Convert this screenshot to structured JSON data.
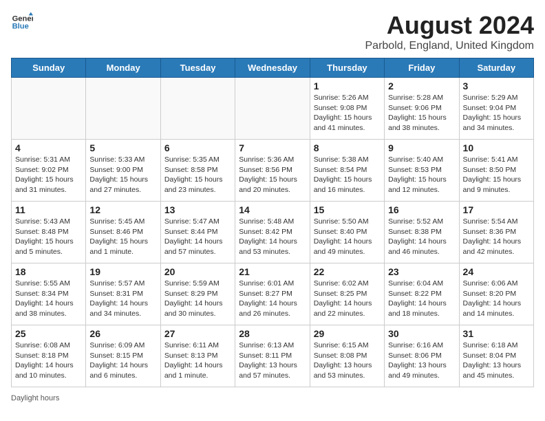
{
  "header": {
    "logo_line1": "General",
    "logo_line2": "Blue",
    "main_title": "August 2024",
    "subtitle": "Parbold, England, United Kingdom"
  },
  "day_headers": [
    "Sunday",
    "Monday",
    "Tuesday",
    "Wednesday",
    "Thursday",
    "Friday",
    "Saturday"
  ],
  "weeks": [
    [
      {
        "date": "",
        "text": ""
      },
      {
        "date": "",
        "text": ""
      },
      {
        "date": "",
        "text": ""
      },
      {
        "date": "",
        "text": ""
      },
      {
        "date": "1",
        "text": "Sunrise: 5:26 AM\nSunset: 9:08 PM\nDaylight: 15 hours\nand 41 minutes."
      },
      {
        "date": "2",
        "text": "Sunrise: 5:28 AM\nSunset: 9:06 PM\nDaylight: 15 hours\nand 38 minutes."
      },
      {
        "date": "3",
        "text": "Sunrise: 5:29 AM\nSunset: 9:04 PM\nDaylight: 15 hours\nand 34 minutes."
      }
    ],
    [
      {
        "date": "4",
        "text": "Sunrise: 5:31 AM\nSunset: 9:02 PM\nDaylight: 15 hours\nand 31 minutes."
      },
      {
        "date": "5",
        "text": "Sunrise: 5:33 AM\nSunset: 9:00 PM\nDaylight: 15 hours\nand 27 minutes."
      },
      {
        "date": "6",
        "text": "Sunrise: 5:35 AM\nSunset: 8:58 PM\nDaylight: 15 hours\nand 23 minutes."
      },
      {
        "date": "7",
        "text": "Sunrise: 5:36 AM\nSunset: 8:56 PM\nDaylight: 15 hours\nand 20 minutes."
      },
      {
        "date": "8",
        "text": "Sunrise: 5:38 AM\nSunset: 8:54 PM\nDaylight: 15 hours\nand 16 minutes."
      },
      {
        "date": "9",
        "text": "Sunrise: 5:40 AM\nSunset: 8:53 PM\nDaylight: 15 hours\nand 12 minutes."
      },
      {
        "date": "10",
        "text": "Sunrise: 5:41 AM\nSunset: 8:50 PM\nDaylight: 15 hours\nand 9 minutes."
      }
    ],
    [
      {
        "date": "11",
        "text": "Sunrise: 5:43 AM\nSunset: 8:48 PM\nDaylight: 15 hours\nand 5 minutes."
      },
      {
        "date": "12",
        "text": "Sunrise: 5:45 AM\nSunset: 8:46 PM\nDaylight: 15 hours\nand 1 minute."
      },
      {
        "date": "13",
        "text": "Sunrise: 5:47 AM\nSunset: 8:44 PM\nDaylight: 14 hours\nand 57 minutes."
      },
      {
        "date": "14",
        "text": "Sunrise: 5:48 AM\nSunset: 8:42 PM\nDaylight: 14 hours\nand 53 minutes."
      },
      {
        "date": "15",
        "text": "Sunrise: 5:50 AM\nSunset: 8:40 PM\nDaylight: 14 hours\nand 49 minutes."
      },
      {
        "date": "16",
        "text": "Sunrise: 5:52 AM\nSunset: 8:38 PM\nDaylight: 14 hours\nand 46 minutes."
      },
      {
        "date": "17",
        "text": "Sunrise: 5:54 AM\nSunset: 8:36 PM\nDaylight: 14 hours\nand 42 minutes."
      }
    ],
    [
      {
        "date": "18",
        "text": "Sunrise: 5:55 AM\nSunset: 8:34 PM\nDaylight: 14 hours\nand 38 minutes."
      },
      {
        "date": "19",
        "text": "Sunrise: 5:57 AM\nSunset: 8:31 PM\nDaylight: 14 hours\nand 34 minutes."
      },
      {
        "date": "20",
        "text": "Sunrise: 5:59 AM\nSunset: 8:29 PM\nDaylight: 14 hours\nand 30 minutes."
      },
      {
        "date": "21",
        "text": "Sunrise: 6:01 AM\nSunset: 8:27 PM\nDaylight: 14 hours\nand 26 minutes."
      },
      {
        "date": "22",
        "text": "Sunrise: 6:02 AM\nSunset: 8:25 PM\nDaylight: 14 hours\nand 22 minutes."
      },
      {
        "date": "23",
        "text": "Sunrise: 6:04 AM\nSunset: 8:22 PM\nDaylight: 14 hours\nand 18 minutes."
      },
      {
        "date": "24",
        "text": "Sunrise: 6:06 AM\nSunset: 8:20 PM\nDaylight: 14 hours\nand 14 minutes."
      }
    ],
    [
      {
        "date": "25",
        "text": "Sunrise: 6:08 AM\nSunset: 8:18 PM\nDaylight: 14 hours\nand 10 minutes."
      },
      {
        "date": "26",
        "text": "Sunrise: 6:09 AM\nSunset: 8:15 PM\nDaylight: 14 hours\nand 6 minutes."
      },
      {
        "date": "27",
        "text": "Sunrise: 6:11 AM\nSunset: 8:13 PM\nDaylight: 14 hours\nand 1 minute."
      },
      {
        "date": "28",
        "text": "Sunrise: 6:13 AM\nSunset: 8:11 PM\nDaylight: 13 hours\nand 57 minutes."
      },
      {
        "date": "29",
        "text": "Sunrise: 6:15 AM\nSunset: 8:08 PM\nDaylight: 13 hours\nand 53 minutes."
      },
      {
        "date": "30",
        "text": "Sunrise: 6:16 AM\nSunset: 8:06 PM\nDaylight: 13 hours\nand 49 minutes."
      },
      {
        "date": "31",
        "text": "Sunrise: 6:18 AM\nSunset: 8:04 PM\nDaylight: 13 hours\nand 45 minutes."
      }
    ]
  ],
  "footer": {
    "daylight_label": "Daylight hours"
  }
}
